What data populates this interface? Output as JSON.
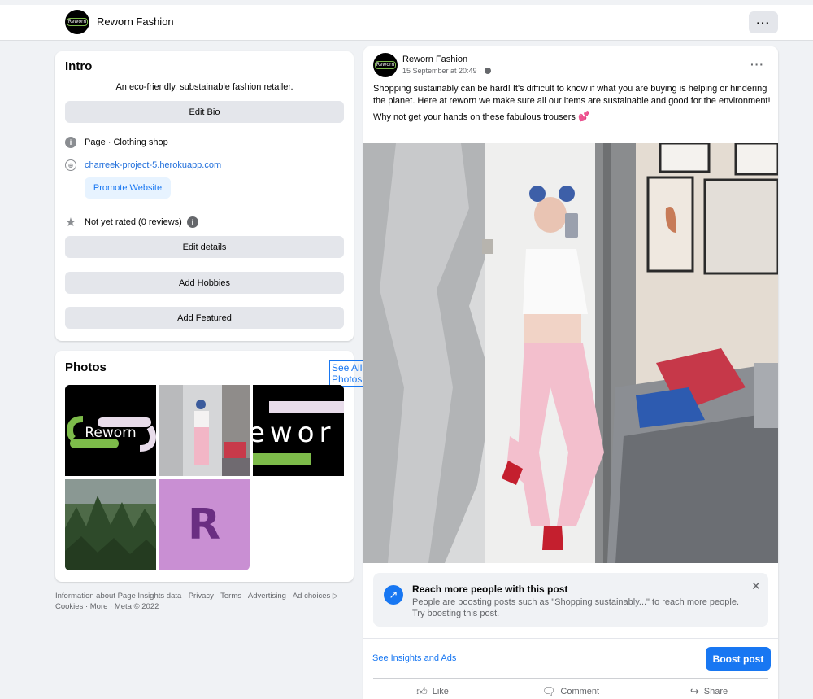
{
  "header": {
    "page_name": "Reworn Fashion",
    "avatar_text": "Reworn",
    "more_label": "···"
  },
  "intro": {
    "title": "Intro",
    "bio": "An eco-friendly, substainable fashion retailer.",
    "edit_bio": "Edit Bio",
    "category": "Page · Clothing shop",
    "website": "charreek-project-5.herokuapp.com",
    "promote_website": "Promote Website",
    "rating": "Not yet rated (0 reviews)",
    "edit_details": "Edit details",
    "add_hobbies": "Add Hobbies",
    "add_featured": "Add Featured"
  },
  "photos": {
    "title": "Photos",
    "see_all": "See All Photos",
    "logo_text": "Reworn",
    "logo_text_partial": "ewor",
    "letter_tile": "R"
  },
  "footer": {
    "text": "Information about Page Insights data · Privacy · Terms · Advertising · Ad choices ▷ · Cookies · More · Meta © 2022"
  },
  "post": {
    "author": "Reworn Fashion",
    "time": "15 September at 20:49 ·",
    "more_label": "···",
    "paragraph1": "Shopping sustainably can be hard! It's difficult to know if what you are buying is helping or hindering the planet. Here at reworn we make sure all our items are sustainable and good for the environment!",
    "paragraph2": "Why not get your hands on these fabulous trousers",
    "emoji": "💕",
    "boost_card": {
      "title": "Reach more people with this post",
      "description": "People are boosting posts such as \"Shopping sustainably...\" to reach more people. Try boosting this post.",
      "close": "✕"
    },
    "insights_link": "See Insights and Ads",
    "boost_button": "Boost post",
    "actions": {
      "like": "Like",
      "comment": "Comment",
      "share": "Share"
    }
  },
  "colors": {
    "accent": "#1877f2",
    "background": "#f0f2f5",
    "button_grey": "#e4e6eb",
    "tile_purple": "#c98fd3",
    "logo_green": "#7dbb4a"
  }
}
